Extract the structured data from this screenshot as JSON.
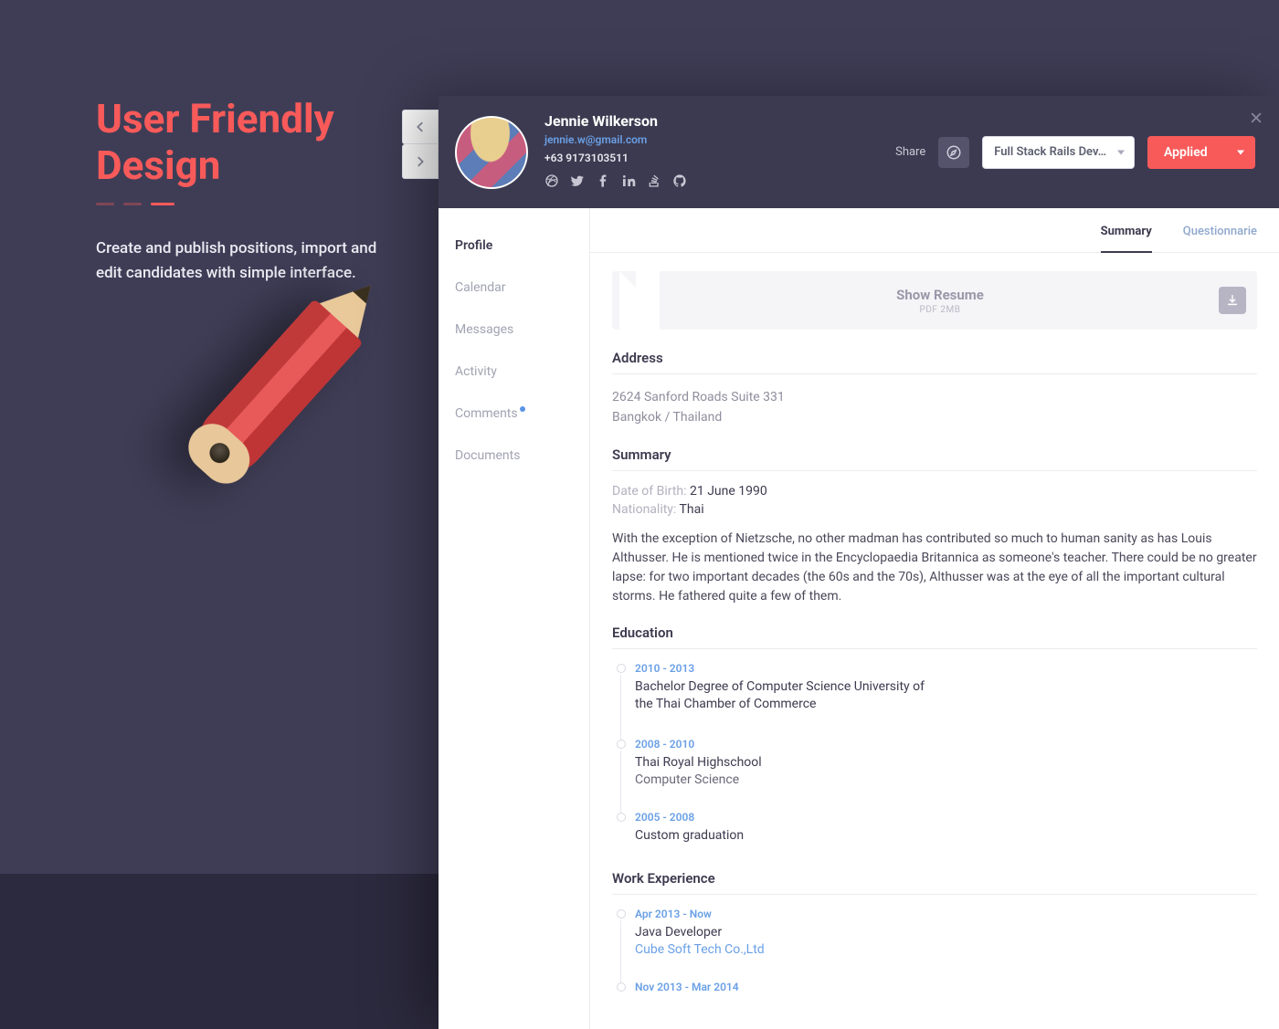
{
  "hero": {
    "title_line1": "User Friendly",
    "title_line2": "Design",
    "subtitle": "Create and publish positions, import and edit candidates with simple interface."
  },
  "candidate": {
    "name": "Jennie Wilkerson",
    "email": "jennie.w@gmail.com",
    "phone": "+63 9173103511",
    "social": [
      "dribbble",
      "twitter",
      "facebook",
      "linkedin",
      "stackoverflow",
      "github"
    ]
  },
  "header_actions": {
    "share": "Share",
    "position_dropdown": "Full Stack Rails Dev…",
    "status": "Applied"
  },
  "side_tabs": {
    "items": [
      {
        "label": "Profile",
        "active": true,
        "dot": false
      },
      {
        "label": "Calendar",
        "active": false,
        "dot": false
      },
      {
        "label": "Messages",
        "active": false,
        "dot": false
      },
      {
        "label": "Activity",
        "active": false,
        "dot": false
      },
      {
        "label": "Comments",
        "active": false,
        "dot": true
      },
      {
        "label": "Documents",
        "active": false,
        "dot": false
      }
    ]
  },
  "top_tabs": {
    "summary": "Summary",
    "questionnarie": "Questionnarie"
  },
  "resume": {
    "title": "Show Resume",
    "meta": "PDF 2MB"
  },
  "sections": {
    "address_title": "Address",
    "address_line1": "2624 Sanford Roads Suite 331",
    "address_line2": "Bangkok / Thailand",
    "summary_title": "Summary",
    "dob_label": "Date of Birth:",
    "dob_value": "21 June 1990",
    "nationality_label": "Nationality:",
    "nationality_value": "Thai",
    "summary_text": "With the exception of Nietzsche, no other madman has contributed so much to human sanity as has Louis Althusser. He is mentioned twice in the Encyclopaedia Britannica as someone's teacher. There could be no greater lapse: for two important decades (the 60s and the 70s), Althusser was at the eye of all the important cultural storms. He fathered quite a few of them.",
    "education_title": "Education",
    "work_title": "Work Experience"
  },
  "education": [
    {
      "date": "2010 - 2013",
      "title": "Bachelor Degree of Computer Science University of the Thai Chamber of Commerce",
      "sub": ""
    },
    {
      "date": "2008 - 2010",
      "title": "Thai Royal Highschool",
      "sub": "Computer Science"
    },
    {
      "date": "2005 - 2008",
      "title": "Custom graduation",
      "sub": ""
    }
  ],
  "work": [
    {
      "date": "Apr 2013 - Now",
      "title": "Java Developer",
      "company": "Cube Soft Tech Co.,Ltd"
    },
    {
      "date": "Nov 2013 - Mar 2014",
      "title": "",
      "company": ""
    }
  ]
}
